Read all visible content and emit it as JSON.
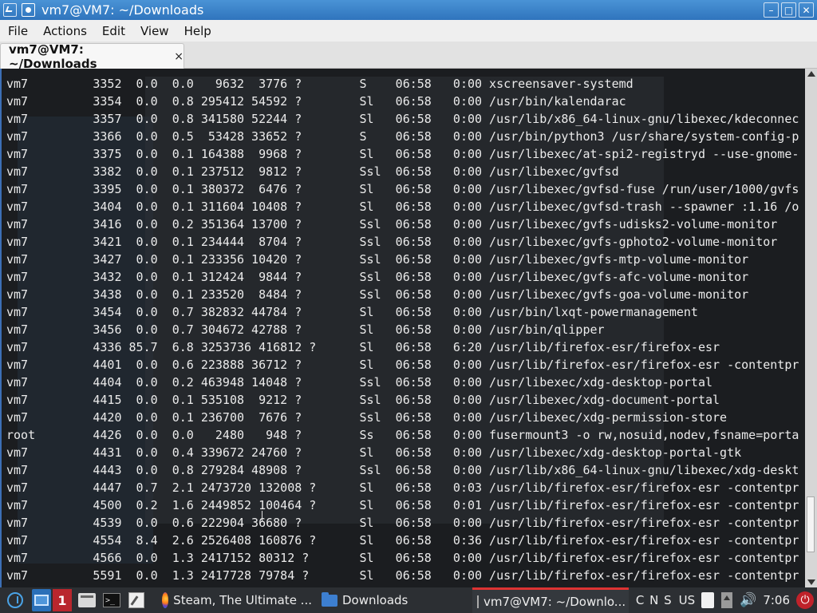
{
  "window": {
    "title": "vm7@VM7: ~/Downloads",
    "controls": {
      "minimize": "–",
      "maximize": "□",
      "close": "✕"
    }
  },
  "menu": {
    "file": "File",
    "actions": "Actions",
    "edit": "Edit",
    "view": "View",
    "help": "Help"
  },
  "tab": {
    "label": "vm7@VM7: ~/Downloads",
    "close": "×"
  },
  "terminal": {
    "lines": [
      "vm7         3352  0.0  0.0   9632  3776 ?        S    06:58   0:00 xscreensaver-systemd",
      "vm7         3354  0.0  0.8 295412 54592 ?        Sl   06:58   0:00 /usr/bin/kalendarac",
      "vm7         3357  0.0  0.8 341580 52244 ?        Sl   06:58   0:00 /usr/lib/x86_64-linux-gnu/libexec/kdeconnec",
      "vm7         3366  0.0  0.5  53428 33652 ?        S    06:58   0:00 /usr/bin/python3 /usr/share/system-config-p",
      "vm7         3375  0.0  0.1 164388  9968 ?        Sl   06:58   0:00 /usr/libexec/at-spi2-registryd --use-gnome-",
      "vm7         3382  0.0  0.1 237512  9812 ?        Ssl  06:58   0:00 /usr/libexec/gvfsd",
      "vm7         3395  0.0  0.1 380372  6476 ?        Sl   06:58   0:00 /usr/libexec/gvfsd-fuse /run/user/1000/gvfs",
      "vm7         3404  0.0  0.1 311604 10408 ?        Sl   06:58   0:00 /usr/libexec/gvfsd-trash --spawner :1.16 /o",
      "vm7         3416  0.0  0.2 351364 13700 ?        Ssl  06:58   0:00 /usr/libexec/gvfs-udisks2-volume-monitor",
      "vm7         3421  0.0  0.1 234444  8704 ?        Ssl  06:58   0:00 /usr/libexec/gvfs-gphoto2-volume-monitor",
      "vm7         3427  0.0  0.1 233356 10420 ?        Ssl  06:58   0:00 /usr/libexec/gvfs-mtp-volume-monitor",
      "vm7         3432  0.0  0.1 312424  9844 ?        Ssl  06:58   0:00 /usr/libexec/gvfs-afc-volume-monitor",
      "vm7         3438  0.0  0.1 233520  8484 ?        Ssl  06:58   0:00 /usr/libexec/gvfs-goa-volume-monitor",
      "vm7         3454  0.0  0.7 382832 44784 ?        Sl   06:58   0:00 /usr/bin/lxqt-powermanagement",
      "vm7         3456  0.0  0.7 304672 42788 ?        Sl   06:58   0:00 /usr/bin/qlipper",
      "vm7         4336 85.7  6.8 3253736 416812 ?      Sl   06:58   6:20 /usr/lib/firefox-esr/firefox-esr",
      "vm7         4401  0.0  0.6 223888 36712 ?        Sl   06:58   0:00 /usr/lib/firefox-esr/firefox-esr -contentpr",
      "vm7         4404  0.0  0.2 463948 14048 ?        Ssl  06:58   0:00 /usr/libexec/xdg-desktop-portal",
      "vm7         4415  0.0  0.1 535108  9212 ?        Ssl  06:58   0:00 /usr/libexec/xdg-document-portal",
      "vm7         4420  0.0  0.1 236700  7676 ?        Ssl  06:58   0:00 /usr/libexec/xdg-permission-store",
      "root        4426  0.0  0.0   2480   948 ?        Ss   06:58   0:00 fusermount3 -o rw,nosuid,nodev,fsname=porta",
      "vm7         4431  0.0  0.4 339672 24760 ?        Sl   06:58   0:00 /usr/libexec/xdg-desktop-portal-gtk",
      "vm7         4443  0.0  0.8 279284 48908 ?        Ssl  06:58   0:00 /usr/lib/x86_64-linux-gnu/libexec/xdg-deskt",
      "vm7         4447  0.7  2.1 2473720 132008 ?      Sl   06:58   0:03 /usr/lib/firefox-esr/firefox-esr -contentpr",
      "vm7         4500  0.2  1.6 2449852 100464 ?      Sl   06:58   0:01 /usr/lib/firefox-esr/firefox-esr -contentpr",
      "vm7         4539  0.0  0.6 222904 36680 ?        Sl   06:58   0:00 /usr/lib/firefox-esr/firefox-esr -contentpr",
      "vm7         4554  8.4  2.6 2526408 160876 ?      Sl   06:58   0:36 /usr/lib/firefox-esr/firefox-esr -contentpr",
      "vm7         4566  0.0  1.3 2417152 80312 ?       Sl   06:58   0:00 /usr/lib/firefox-esr/firefox-esr -contentpr",
      "vm7         5591  0.0  1.3 2417728 79784 ?       Sl   06:58   0:00 /usr/lib/firefox-esr/firefox-esr -contentpr"
    ]
  },
  "taskbar": {
    "workspace_number": "1",
    "tasks": [
      {
        "label": "Steam, The Ultimate ...",
        "icon": "firefox-icon"
      },
      {
        "label": "Downloads",
        "icon": "folder-icon"
      },
      {
        "label": "vm7@VM7: ~/Downlo...",
        "icon": "terminal-icon"
      }
    ],
    "keyboard_indicators": "C N S",
    "language": "US",
    "clock": "7:06"
  }
}
